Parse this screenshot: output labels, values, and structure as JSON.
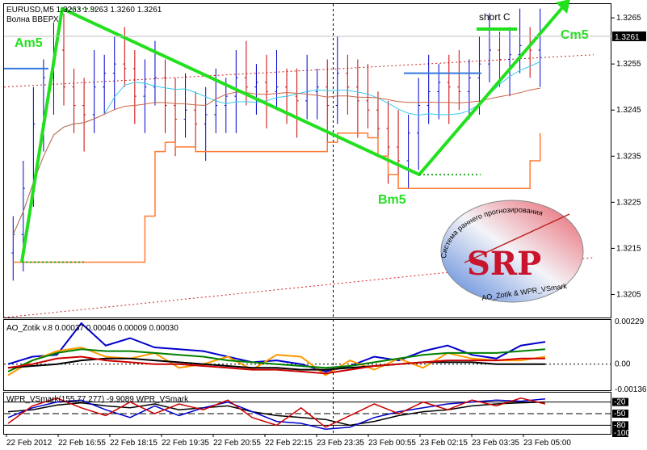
{
  "header": {
    "symbol_line": "EURUSD,M5  1.3263 1.3263 1.3260 1.3261",
    "indicator_name": "Волна ВВЕРХ"
  },
  "chart_data": [
    {
      "type": "candlestick",
      "title": "EURUSD,M5",
      "ohlc_current": [
        1.3263,
        1.3263,
        1.326,
        1.3261
      ],
      "price_axis": {
        "ticks": [
          "1.3265",
          "1.3255",
          "1.3245",
          "1.3235",
          "1.3225",
          "1.3215",
          "1.3205"
        ],
        "current_price": "1.3261",
        "ylim": [
          1.32,
          1.3268
        ]
      },
      "time_axis": [
        "22 Feb 2012",
        "22 Feb 16:55",
        "22 Feb 18:15",
        "22 Feb 19:35",
        "22 Feb 20:55",
        "22 Feb 22:15",
        "23 Feb 23:35",
        "23 Feb 00:55",
        "23 Feb 02:15",
        "23 Feb 03:35",
        "23 Feb 05:00"
      ],
      "close_series": [
        1.3218,
        1.3228,
        1.3242,
        1.3252,
        1.3258,
        1.325,
        1.3246,
        1.3244,
        1.325,
        1.3253,
        1.3255,
        1.3254,
        1.3248,
        1.325,
        1.3252,
        1.3246,
        1.3243,
        1.3245,
        1.3242,
        1.3244,
        1.3246,
        1.3248,
        1.3252,
        1.325,
        1.3251,
        1.3249,
        1.325,
        1.3248,
        1.3247,
        1.3249,
        1.325,
        1.3246,
        1.3253,
        1.325,
        1.3247,
        1.3245,
        1.3241,
        1.3237,
        1.3234,
        1.324,
        1.3246,
        1.3249,
        1.3251,
        1.325,
        1.3249,
        1.3252,
        1.3255,
        1.3258,
        1.3256,
        1.3257,
        1.3259,
        1.3258,
        1.3261
      ],
      "elliott_wave": [
        {
          "label": "Am5",
          "price": 1.3267
        },
        {
          "label": "Bm5",
          "price": 1.3231
        },
        {
          "label": "Cm5",
          "price": 1.3268
        }
      ],
      "wave_start_price": 1.3212,
      "annotation": "short C"
    },
    {
      "type": "line",
      "title": "AO_Zotik v.8 0.00037 0.00046 0.00009 0.00030",
      "y_ticks": [
        "0.00229",
        "0.00",
        "-0.00136"
      ],
      "series": [
        {
          "color": "#0000cc",
          "values": [
            0.0,
            0.0004,
            0.0005,
            0.0022,
            0.001,
            0.0014,
            0.0009,
            0.0008,
            0.0007,
            0.0004,
            0.0001,
            0.0002,
            0.0,
            -0.0004,
            -0.0001,
            0.0004,
            0.0002,
            0.0007,
            0.001,
            0.0005,
            0.0003,
            0.001,
            0.0012
          ]
        },
        {
          "color": "#ff9900",
          "values": [
            -0.0006,
            0.0002,
            0.0007,
            0.0009,
            0.0004,
            0.0003,
            0.0006,
            -0.0002,
            0.0,
            0.0004,
            -0.0003,
            0.0005,
            0.0004,
            -0.0006,
            0.0002,
            -0.0003,
            0.0003,
            -0.0002,
            0.0006,
            0.0003,
            0.0002,
            0.0002,
            0.0004
          ]
        },
        {
          "color": "#008000",
          "values": [
            -0.0004,
            0.0002,
            0.0006,
            0.0008,
            0.0007,
            0.0007,
            0.0006,
            0.0005,
            0.0004,
            0.0002,
            0.0001,
            0.0,
            -0.0001,
            -0.0002,
            -0.0001,
            0.0001,
            0.0003,
            0.0005,
            0.0006,
            0.0006,
            0.0006,
            0.0007,
            0.0008
          ]
        },
        {
          "color": "#000000",
          "values": [
            -0.0002,
            -0.0001,
            0.0,
            0.0002,
            0.0003,
            0.0003,
            0.0002,
            0.0001,
            0.0,
            -0.0001,
            -0.0002,
            -0.0002,
            -0.0003,
            -0.0003,
            -0.0002,
            -0.0001,
            0.0,
            0.0001,
            0.0001,
            0.0001,
            0.0,
            0.0,
            0.0
          ]
        },
        {
          "color": "#cc0000",
          "values": [
            -0.0002,
            0.0,
            0.0003,
            0.0004,
            0.0002,
            0.0001,
            0.0,
            0.0,
            -0.0001,
            -0.0002,
            -0.0003,
            -0.0003,
            -0.0004,
            -0.0005,
            -0.0003,
            -0.0001,
            0.0,
            0.0001,
            0.0002,
            0.0002,
            0.0002,
            0.0003,
            0.0003
          ]
        }
      ]
    },
    {
      "type": "line",
      "title": "WPR_VSmark(155,77,277) -9.9089 WPR_VSmark",
      "y_ticks": [
        "-20",
        "-50",
        "-80",
        "-100"
      ],
      "series": [
        {
          "color": "#000000",
          "values": [
            -45,
            -40,
            -28,
            -22,
            -30,
            -35,
            -25,
            -40,
            -35,
            -30,
            -45,
            -55,
            -60,
            -65,
            -80,
            -70,
            -55,
            -45,
            -40,
            -30,
            -25,
            -22,
            -20
          ]
        },
        {
          "color": "#0000cc",
          "values": [
            -60,
            -35,
            -20,
            -15,
            -40,
            -60,
            -30,
            -55,
            -35,
            -20,
            -45,
            -70,
            -75,
            -90,
            -85,
            -60,
            -45,
            -35,
            -25,
            -20,
            -15,
            -18,
            -12
          ]
        },
        {
          "color": "#cc0000",
          "values": [
            -75,
            -30,
            -10,
            -35,
            -55,
            -20,
            -50,
            -25,
            -40,
            -15,
            -60,
            -80,
            -35,
            -85,
            -55,
            -25,
            -50,
            -20,
            -40,
            -15,
            -30,
            -10,
            -25
          ]
        }
      ]
    }
  ],
  "logo": {
    "letters": "SRP",
    "arc_text": "Система раннего прогнозирования",
    "bottom_text": "AO_Zotik & WPR_VSmark"
  },
  "colors": {
    "wave": "#22e01e",
    "bull_candle": "#0000cc",
    "bear_candle": "#cc0000",
    "trend_orange": "#ff7a33",
    "ma_cyan": "#33ccee"
  }
}
